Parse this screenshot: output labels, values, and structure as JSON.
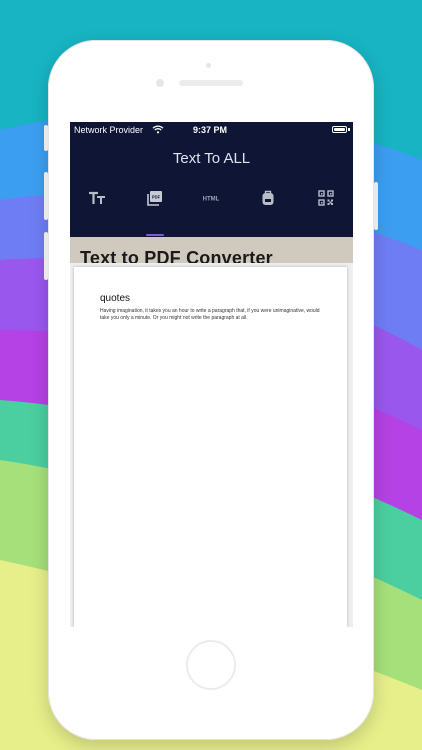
{
  "colors": {
    "nav_background": "#0e1535",
    "tab_indicator": "#7b5ad7",
    "header_strip": "#d0c9be",
    "phone_body": "#ffffff"
  },
  "status_bar": {
    "carrier": "Network Provider",
    "time": "9:37 PM"
  },
  "app": {
    "title": "Text To ALL"
  },
  "tabs": [
    {
      "icon": "text-format-icon",
      "selected": false
    },
    {
      "icon": "pdf-icon",
      "selected": true
    },
    {
      "icon": "html-icon",
      "label": "HTML",
      "selected": false
    },
    {
      "icon": "backpack-icon",
      "selected": false
    },
    {
      "icon": "qr-code-icon",
      "selected": false
    }
  ],
  "page": {
    "heading": "Text to PDF Converter"
  },
  "pdf_preview": {
    "title": "quotes",
    "body": "Having imagination, it takes you an hour to write a paragraph that, if you were unimaginative, would take you only a minute. Or you might not write the paragraph at all."
  }
}
